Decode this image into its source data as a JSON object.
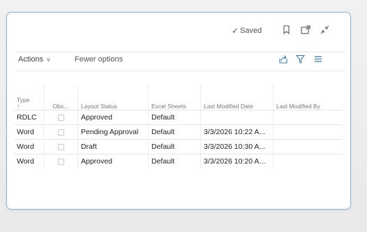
{
  "toolbar": {
    "saved_label": "Saved",
    "icons": [
      "bookmark-icon",
      "open-in-new-window-icon",
      "collapse-icon"
    ]
  },
  "actionbar": {
    "actions_label": "Actions",
    "fewer_options_label": "Fewer options",
    "icons": [
      "share-icon",
      "filter-icon",
      "list-view-icon"
    ]
  },
  "table": {
    "headers": {
      "type": "Type",
      "obsolete": "Obs...",
      "layout_status": "Layout Status",
      "excel_sheets": "Excel Sheets",
      "last_modified_date": "Last Modified Date",
      "last_modified_by": "Last Modified By"
    },
    "rows": [
      {
        "type": "RDLC",
        "obsolete": false,
        "layout_status": "Approved",
        "excel_sheets": "Default",
        "last_modified_date": "",
        "last_modified_by": ""
      },
      {
        "type": "Word",
        "obsolete": false,
        "layout_status": "Pending Approval",
        "excel_sheets": "Default",
        "last_modified_date": "3/3/2026 10:22 A...",
        "last_modified_by": ""
      },
      {
        "type": "Word",
        "obsolete": false,
        "layout_status": "Draft",
        "excel_sheets": "Default",
        "last_modified_date": "3/3/2026 10:30 A...",
        "last_modified_by": ""
      },
      {
        "type": "Word",
        "obsolete": false,
        "layout_status": "Approved",
        "excel_sheets": "Default",
        "last_modified_date": "3/3/2026 10:20 A...",
        "last_modified_by": ""
      }
    ]
  },
  "colors": {
    "card_border": "#8ab6d6",
    "text": "#222222",
    "muted": "#777777"
  }
}
